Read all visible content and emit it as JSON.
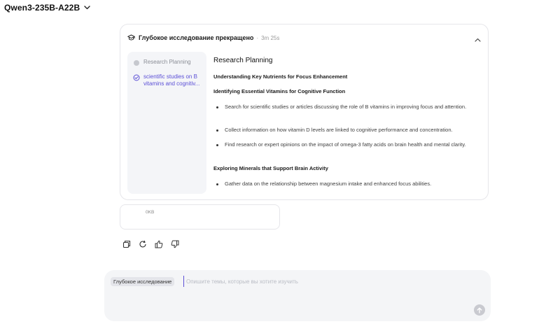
{
  "header": {
    "model_name": "Qwen3-235B-A22B"
  },
  "research": {
    "title": "Глубокое исследование прекращено",
    "separator": "·",
    "elapsed": "3m 25s",
    "steps": [
      {
        "label": "Research Planning",
        "state": "inactive"
      },
      {
        "label": "scientific studies on B vitamins and cognitiv...",
        "state": "active"
      }
    ],
    "content": {
      "heading": "Research Planning",
      "section1": "Understanding Key Nutrients for Focus Enhancement",
      "section2": "Identifying Essential Vitamins for Cognitive Function",
      "bullets": [
        "Search for scientific studies or articles discussing the role of B vitamins in improving focus and attention.",
        "Collect information on how vitamin D levels are linked to cognitive performance and concentration.",
        "Find research or expert opinions on the impact of omega-3 fatty acids on brain health and mental clarity."
      ],
      "section3": "Exploring Minerals that Support Brain Activity",
      "bullets2": [
        "Gather data on the relationship between magnesium intake and enhanced focus abilities."
      ]
    }
  },
  "file": {
    "size": "0KB"
  },
  "actions": [
    "copy-icon",
    "regenerate-icon",
    "thumbs-up-icon",
    "thumbs-down-icon"
  ],
  "composer": {
    "mode": "Глубокое исследование",
    "placeholder": "Опишите темы, которые вы хотите изучить"
  },
  "colors": {
    "accent": "#5b4fd6",
    "muted": "#8b8e96",
    "composer_bg": "#f4f5f7"
  }
}
